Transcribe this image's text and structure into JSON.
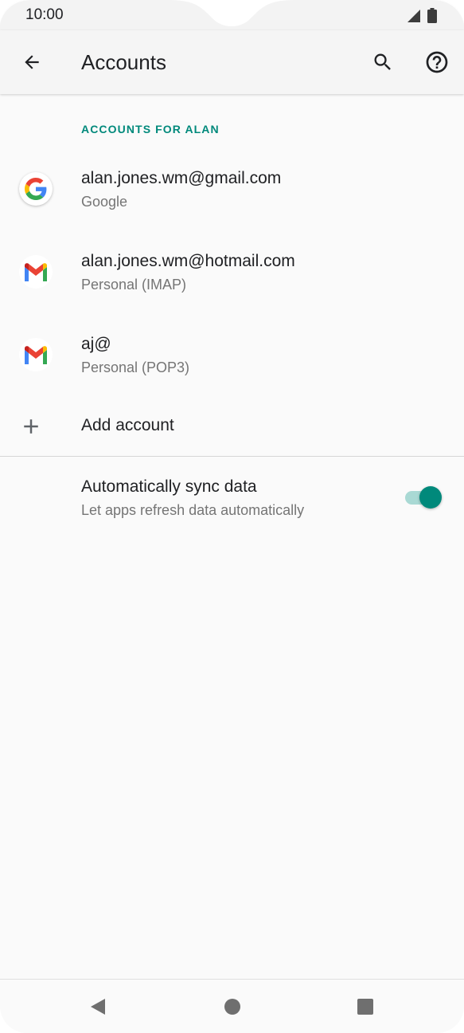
{
  "status_bar": {
    "time": "10:00"
  },
  "app_bar": {
    "title": "Accounts",
    "icons": [
      "arrow-left-icon",
      "search-icon",
      "help-circle-icon"
    ]
  },
  "section_header": "ACCOUNTS FOR ALAN",
  "accounts": [
    {
      "email": "alan.jones.wm@gmail.com",
      "type": "Google",
      "icon": "google-logo-icon"
    },
    {
      "email": "alan.jones.wm@hotmail.com",
      "type": "Personal (IMAP)",
      "icon": "gmail-logo-icon"
    },
    {
      "email": "aj@",
      "type": "Personal (POP3)",
      "icon": "gmail-logo-icon"
    }
  ],
  "add_account": {
    "label": "Add account",
    "icon": "plus-icon"
  },
  "sync": {
    "title": "Automatically sync data",
    "subtitle": "Let apps refresh data automatically",
    "enabled": true
  },
  "colors": {
    "accent": "#00897b",
    "accent_track": "#a9d9d4",
    "text_primary": "#202124",
    "text_secondary": "#757575",
    "background": "#fafafa"
  },
  "nav_bar": {
    "icons": [
      "nav-back-icon",
      "nav-home-icon",
      "nav-recents-icon"
    ]
  }
}
